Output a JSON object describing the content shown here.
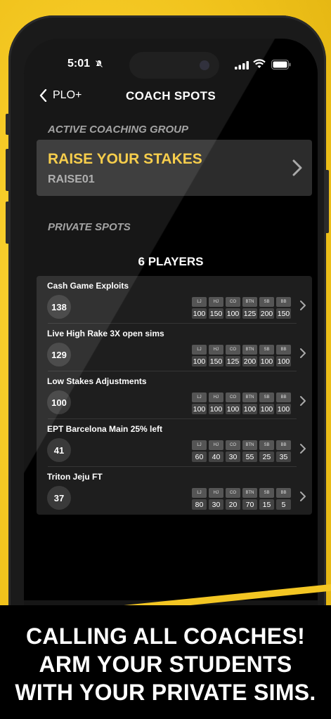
{
  "status_bar": {
    "time": "5:01"
  },
  "nav": {
    "back_label": "PLO+",
    "title": "COACH SPOTS"
  },
  "active_group": {
    "section_label": "ACTIVE COACHING GROUP",
    "name": "RAISE YOUR STAKES",
    "code": "RAISE01"
  },
  "private_spots": {
    "section_label": "PRIVATE SPOTS",
    "players_label": "6 PLAYERS",
    "positions": [
      "LJ",
      "HJ",
      "CO",
      "BTN",
      "SB",
      "BB"
    ],
    "spots": [
      {
        "name": "Cash Game Exploits",
        "count": "138",
        "stacks": [
          "100",
          "150",
          "100",
          "125",
          "200",
          "150"
        ]
      },
      {
        "name": "Live High Rake 3X open sims",
        "count": "129",
        "stacks": [
          "100",
          "150",
          "125",
          "200",
          "100",
          "100"
        ]
      },
      {
        "name": "Low Stakes Adjustments",
        "count": "100",
        "stacks": [
          "100",
          "100",
          "100",
          "100",
          "100",
          "100"
        ]
      },
      {
        "name": "EPT Barcelona Main 25% left",
        "count": "41",
        "stacks": [
          "60",
          "40",
          "30",
          "55",
          "25",
          "35"
        ]
      },
      {
        "name": "Triton Jeju FT",
        "count": "37",
        "stacks": [
          "80",
          "30",
          "20",
          "70",
          "15",
          "5"
        ]
      }
    ]
  },
  "banner": {
    "line1": "CALLING ALL COACHES!",
    "line2": "ARM YOUR STUDENTS",
    "line3": "WITH YOUR PRIVATE SIMS."
  },
  "colors": {
    "accent": "#f5c83a",
    "background": "#000000",
    "card": "#2c2c2c"
  }
}
